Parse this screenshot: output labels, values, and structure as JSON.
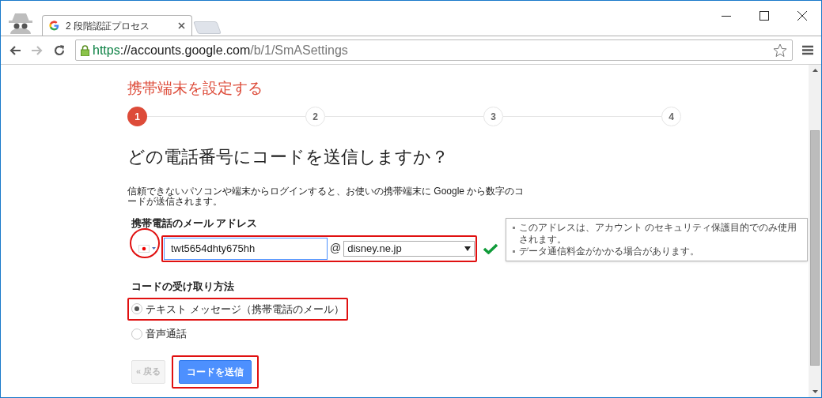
{
  "browser": {
    "tab_title": "2 段階認証プロセス",
    "url": {
      "scheme": "https",
      "host": "://accounts.google.com",
      "path": "/b/1/SmASettings"
    }
  },
  "page": {
    "title": "携帯端末を設定する",
    "steps": [
      {
        "label": "1",
        "selected": true
      },
      {
        "label": "2",
        "selected": false
      },
      {
        "label": "3",
        "selected": false
      },
      {
        "label": "4",
        "selected": false
      }
    ],
    "heading": "どの電話番号にコードを送信しますか？",
    "description": "信頼できないパソコンや端末からログインすると、お使いの携帯端末に Google から数字のコードが送信されます。",
    "email_label": "携帯電話のメール アドレス",
    "email_user": "twt5654dhty675hh",
    "at_sign": "@",
    "email_domain": "disney.ne.jp",
    "valid": true,
    "tooltip": [
      "このアドレスは、アカウント のセキュリティ保護目的でのみ使用されます。",
      "データ通信料金がかかる場合があります。"
    ],
    "method_label": "コードの受け取り方法",
    "methods": [
      {
        "label": "テキスト メッセージ（携帯電話のメール）",
        "selected": true
      },
      {
        "label": "音声通話",
        "selected": false
      }
    ],
    "back_button": "« 戻る",
    "send_button": "コードを送信"
  }
}
